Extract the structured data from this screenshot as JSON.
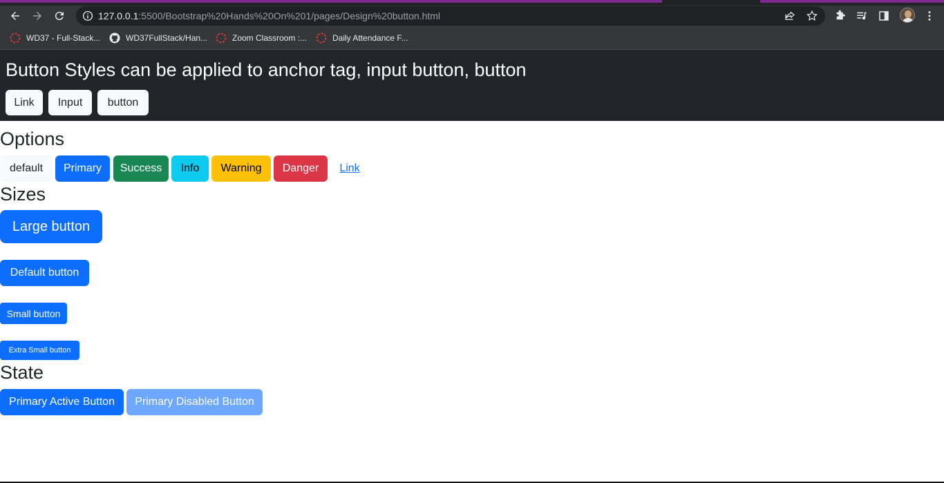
{
  "browser": {
    "url_host": "127.0.0.1",
    "url_rest": ":5500/Bootstrap%20Hands%20On%201/pages/Design%20button.html",
    "bookmarks": [
      {
        "label": "WD37 - Full-Stack...",
        "icon": "loading-circle-icon"
      },
      {
        "label": "WD37FullStack/Han...",
        "icon": "github-icon"
      },
      {
        "label": "Zoom Classroom :...",
        "icon": "loading-circle-icon"
      },
      {
        "label": "Daily Attendance F...",
        "icon": "loading-circle-icon"
      }
    ]
  },
  "hero": {
    "title": "Button Styles can be applied to anchor tag, input button, button",
    "buttons": [
      "Link",
      "Input",
      "button"
    ]
  },
  "options": {
    "heading": "Options",
    "buttons": [
      "default",
      "Primary",
      "Success",
      "Info",
      "Warning",
      "Danger",
      "Link"
    ]
  },
  "sizes": {
    "heading": "Sizes",
    "buttons": [
      "Large button",
      "Default button",
      "Small button",
      "Extra Small button"
    ]
  },
  "state": {
    "heading": "State",
    "buttons": [
      "Primary Active Button",
      "Primary Disabled Button"
    ]
  },
  "colors": {
    "primary": "#0d6efd",
    "success": "#198754",
    "info": "#0dcaf0",
    "warning": "#ffc107",
    "danger": "#dc3545",
    "dark": "#212529",
    "light": "#f8f9fa"
  }
}
